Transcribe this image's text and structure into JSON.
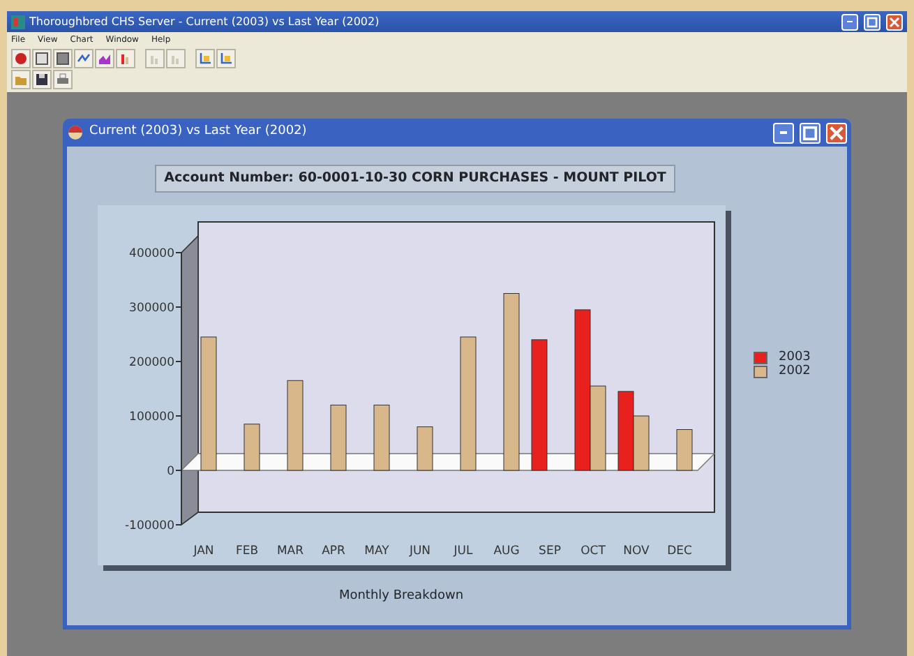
{
  "window": {
    "title": "Thoroughbred CHS Server - Current (2003) vs Last Year (2002)"
  },
  "menu": [
    "File",
    "View",
    "Chart",
    "Window",
    "Help"
  ],
  "child_window": {
    "title": "Current (2003) vs Last Year (2002)",
    "heading": "Account Number: 60-0001-10-30 CORN PURCHASES - MOUNT PILOT",
    "chart_data": {
      "type": "bar",
      "xlabel": "Monthly Breakdown",
      "categories": [
        "JAN",
        "FEB",
        "MAR",
        "APR",
        "MAY",
        "JUN",
        "JUL",
        "AUG",
        "SEP",
        "OCT",
        "NOV",
        "DEC"
      ],
      "series": [
        {
          "name": "2003",
          "color": "#e8201e",
          "values": [
            0,
            0,
            0,
            0,
            0,
            0,
            0,
            0,
            240000,
            295000,
            145000,
            0
          ]
        },
        {
          "name": "2002",
          "color": "#d8b88a",
          "values": [
            245000,
            85000,
            165000,
            120000,
            120000,
            80000,
            245000,
            325000,
            0,
            155000,
            100000,
            75000
          ]
        }
      ],
      "ylim": [
        -100000,
        400000
      ],
      "yticks": [
        -100000,
        0,
        100000,
        200000,
        300000,
        400000
      ]
    }
  }
}
